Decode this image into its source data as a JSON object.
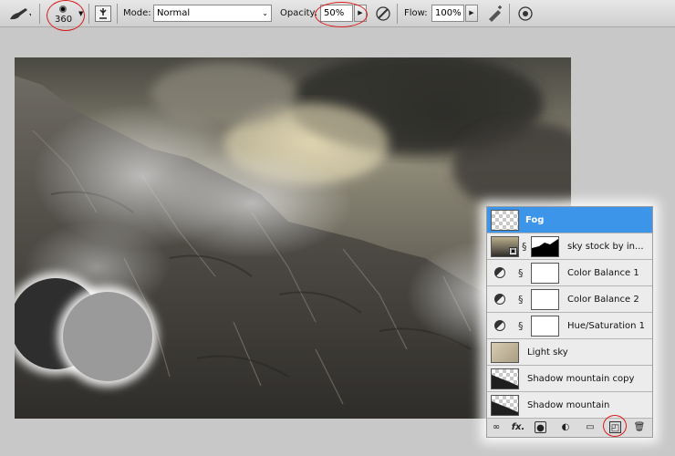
{
  "toolbar": {
    "brush_size": "360",
    "mode_label": "Mode:",
    "mode_value": "Normal",
    "opacity_label": "Opacity:",
    "opacity_value": "50%",
    "flow_label": "Flow:",
    "flow_value": "100%",
    "icons": [
      "brush-tool-icon",
      "brush-preset-icon",
      "brush-panel-icon",
      "tablet-pressure-opacity-icon",
      "airbrush-icon",
      "tablet-pressure-size-icon"
    ]
  },
  "layers": [
    {
      "name": "Fog",
      "selected": true,
      "thumb": "transparent"
    },
    {
      "name": "sky stock by in...",
      "selected": false,
      "thumb": "sky-with-mask"
    },
    {
      "name": "Color Balance 1",
      "selected": false,
      "thumb": "adjustment"
    },
    {
      "name": "Color Balance 2",
      "selected": false,
      "thumb": "adjustment"
    },
    {
      "name": "Hue/Saturation 1",
      "selected": false,
      "thumb": "adjustment"
    },
    {
      "name": "Light sky",
      "selected": false,
      "thumb": "pixel"
    },
    {
      "name": "Shadow mountain copy",
      "selected": false,
      "thumb": "pixel"
    },
    {
      "name": "Shadow mountain",
      "selected": false,
      "thumb": "pixel"
    }
  ],
  "panel_footer_icons": [
    "link-layers-icon",
    "fx-icon",
    "add-mask-icon",
    "adjustment-layer-icon",
    "new-group-icon",
    "new-layer-icon",
    "trash-icon"
  ],
  "colors": {
    "selection": "#3d95e9",
    "annotation": "#d91a1a",
    "foreground_swatch": "#2f2e2e",
    "background_swatch": "#9a9a9a"
  }
}
